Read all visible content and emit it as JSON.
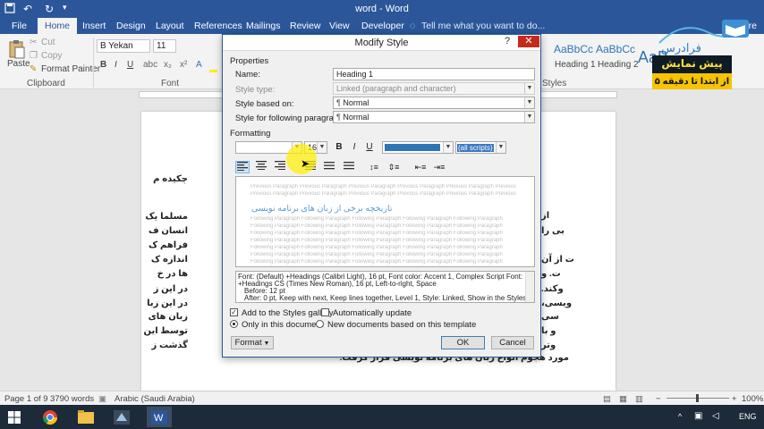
{
  "window": {
    "title": "word - Word"
  },
  "quick_access": {
    "icons": [
      "save-icon",
      "undo-icon",
      "redo-icon",
      "customize-icon"
    ]
  },
  "tabs": [
    "File",
    "Home",
    "Insert",
    "Design",
    "Layout",
    "References",
    "Mailings",
    "Review",
    "View",
    "Developer"
  ],
  "tell_me": "Tell me what you want to do...",
  "share": "Share",
  "ribbon": {
    "clipboard": {
      "paste": "Paste",
      "cut": "Cut",
      "copy": "Copy",
      "format_painter": "Format Painter",
      "label": "Clipboard"
    },
    "font": {
      "name": "B Yekan",
      "size": "11",
      "label": "Font",
      "bold": "B",
      "italic": "I",
      "underline": "U"
    },
    "styles": {
      "items": [
        "AaBbCc",
        "AaBbCc"
      ],
      "names": [
        "Heading 1",
        "Heading 2"
      ],
      "label": "Styles",
      "aab": "AaB"
    }
  },
  "watermark": {
    "logo": "فرادرس",
    "badge": "پیش نمایش",
    "sub": "از ابتدا تا دقیقه ۵"
  },
  "document": {
    "lines": [
      "چکیده م",
      "مسلما یک",
      "انسان ف",
      "فراهم ک",
      "اندازه ک",
      "ها در خ",
      "در این ز",
      "در این زبا",
      "زبان های",
      "توسط این",
      "گذشت ز",
      "مورد هجوم انواع زبان های برنامه نویسی قرار گرفت."
    ],
    "right_lines": [
      "از",
      "بی را",
      "ت از آن",
      "ت. و",
      "وکند.",
      "ویسی،",
      "سی",
      "و با",
      "وتر"
    ]
  },
  "dialog": {
    "title": "Modify Style",
    "help": "?",
    "close": "✕",
    "properties_label": "Properties",
    "name_label": "Name:",
    "name_value": "Heading 1",
    "style_type_label": "Style type:",
    "style_type_value": "Linked (paragraph and character)",
    "based_on_label": "Style based on:",
    "based_on_value": "Normal",
    "following_label": "Style for following paragraph:",
    "following_value": "Normal",
    "formatting_label": "Formatting",
    "font_size": "16",
    "bold": "B",
    "italic": "I",
    "underline": "U",
    "script_value": "(all scripts)",
    "preview_prev": "Previous Paragraph Previous Paragraph Previous Paragraph Previous Paragraph Previous Paragraph Previous",
    "preview_heading": "تاریخچه برخی از زبان های برنامه نویسی",
    "preview_next": "Following Paragraph Following Paragraph Following Paragraph Following Paragraph Following Paragraph",
    "description": [
      "Font: (Default) +Headings (Calibri Light), 16 pt, Font color: Accent 1, Complex Script Font:",
      "+Headings CS (Times New Roman), 16 pt, Left-to-right, Space",
      "Before:  12 pt",
      "After:  0 pt, Keep with next, Keep lines together, Level 1, Style: Linked, Show in the Styles"
    ],
    "add_to_gallery": "Add to the Styles gallery",
    "auto_update": "Automatically update",
    "only_this_doc": "Only in this document",
    "new_docs": "New documents based on this template",
    "format_btn": "Format",
    "ok": "OK",
    "cancel": "Cancel"
  },
  "status": {
    "page": "Page 1 of 9",
    "words": "3790 words",
    "language": "Arabic (Saudi Arabia)",
    "zoom": "100%"
  },
  "taskbar": {
    "lang": "ENG"
  }
}
